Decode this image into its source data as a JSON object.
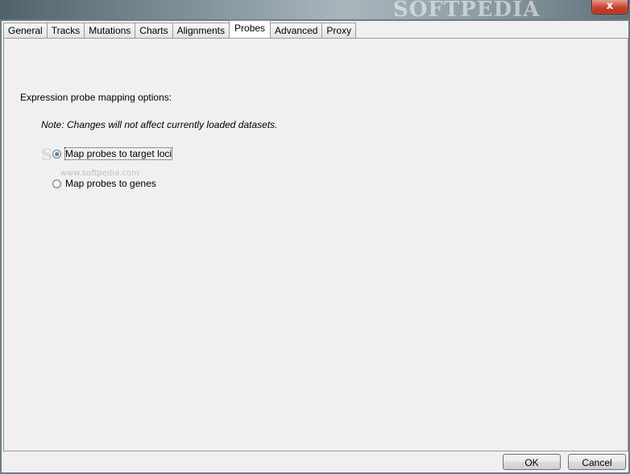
{
  "window": {
    "watermark": "SOFTPEDIA",
    "close_label": "x"
  },
  "tabs": [
    {
      "label": "General",
      "selected": false
    },
    {
      "label": "Tracks",
      "selected": false
    },
    {
      "label": "Mutations",
      "selected": false
    },
    {
      "label": "Charts",
      "selected": false
    },
    {
      "label": "Alignments",
      "selected": false
    },
    {
      "label": "Probes",
      "selected": true
    },
    {
      "label": "Advanced",
      "selected": false
    },
    {
      "label": "Proxy",
      "selected": false
    }
  ],
  "probes": {
    "heading": "Expression probe mapping options:",
    "note": "Note: Changes will not affect currently loaded datasets.",
    "options": [
      {
        "label": "Map probes to target loci",
        "checked": true
      },
      {
        "label": "Map probes to genes",
        "checked": false
      }
    ],
    "watermark_url": "www.softpedia.com",
    "watermark_glyph": "S"
  },
  "buttons": {
    "ok": "OK",
    "cancel": "Cancel"
  }
}
